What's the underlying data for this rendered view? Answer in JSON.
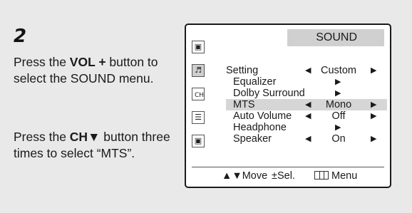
{
  "step": {
    "number": "2"
  },
  "instructions": {
    "p1_pre": "Press the ",
    "p1_bold": "VOL +",
    "p1_post": " button to select the SOUND menu.",
    "p2_pre": "Press the ",
    "p2_bold": "CH▼",
    "p2_post": " button three times to select “MTS”."
  },
  "osd": {
    "title": "SOUND",
    "icons": [
      "tv-icon",
      "sound-icon",
      "channel-icon",
      "function-icon",
      "setup-icon"
    ],
    "active_icon_index": 1,
    "rows": [
      {
        "label": "Setting",
        "value": "Custom",
        "type": "value"
      },
      {
        "label": "Equalizer",
        "value": "",
        "type": "submenu"
      },
      {
        "label": "Dolby Surround",
        "value": "",
        "type": "submenu"
      },
      {
        "label": "MTS",
        "value": "Mono",
        "type": "value"
      },
      {
        "label": "Auto Volume",
        "value": "Off",
        "type": "value"
      },
      {
        "label": "Headphone",
        "value": "",
        "type": "submenu"
      },
      {
        "label": "Speaker",
        "value": "On",
        "type": "value"
      }
    ],
    "highlight_index": 3,
    "footer": {
      "move": "▲▼Move",
      "sel": "±Sel.",
      "menu": "Menu"
    }
  }
}
